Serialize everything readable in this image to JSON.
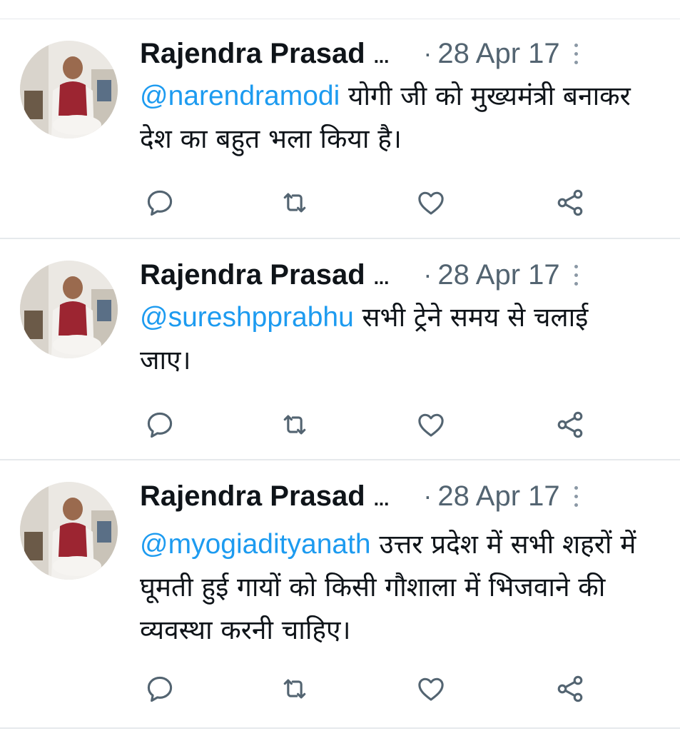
{
  "tweets": [
    {
      "author": "Rajendra Prasad",
      "ellipsis": "...",
      "separator": "·",
      "date": "28 Apr 17",
      "mention": "@narendramodi",
      "body": " योगी जी  को मुख्यमंत्री बनाकर देश का बहुत भला किया है।"
    },
    {
      "author": "Rajendra Prasad",
      "ellipsis": "...",
      "separator": "·",
      "date": "28 Apr 17",
      "mention": "@sureshpprabhu",
      "body": " सभी ट्रेने समय से चलाई जाए।"
    },
    {
      "author": "Rajendra Prasad",
      "ellipsis": "...",
      "separator": "·",
      "date": "28 Apr 17",
      "mention": "@myogiadityanath",
      "body": " उत्तर प्रदेश में सभी शहरों में घूमती हुई गायों को किसी गौशाला में भिजवाने की व्यवस्था करनी चाहिए।"
    }
  ],
  "action_icons": [
    "reply-icon",
    "retweet-icon",
    "like-icon",
    "share-icon"
  ],
  "more_icon": "more-vertical-icon",
  "colors": {
    "mention": "#1d9bf0",
    "secondary_text": "#536471",
    "icon": "#536471",
    "divider": "#e6e9ec"
  }
}
